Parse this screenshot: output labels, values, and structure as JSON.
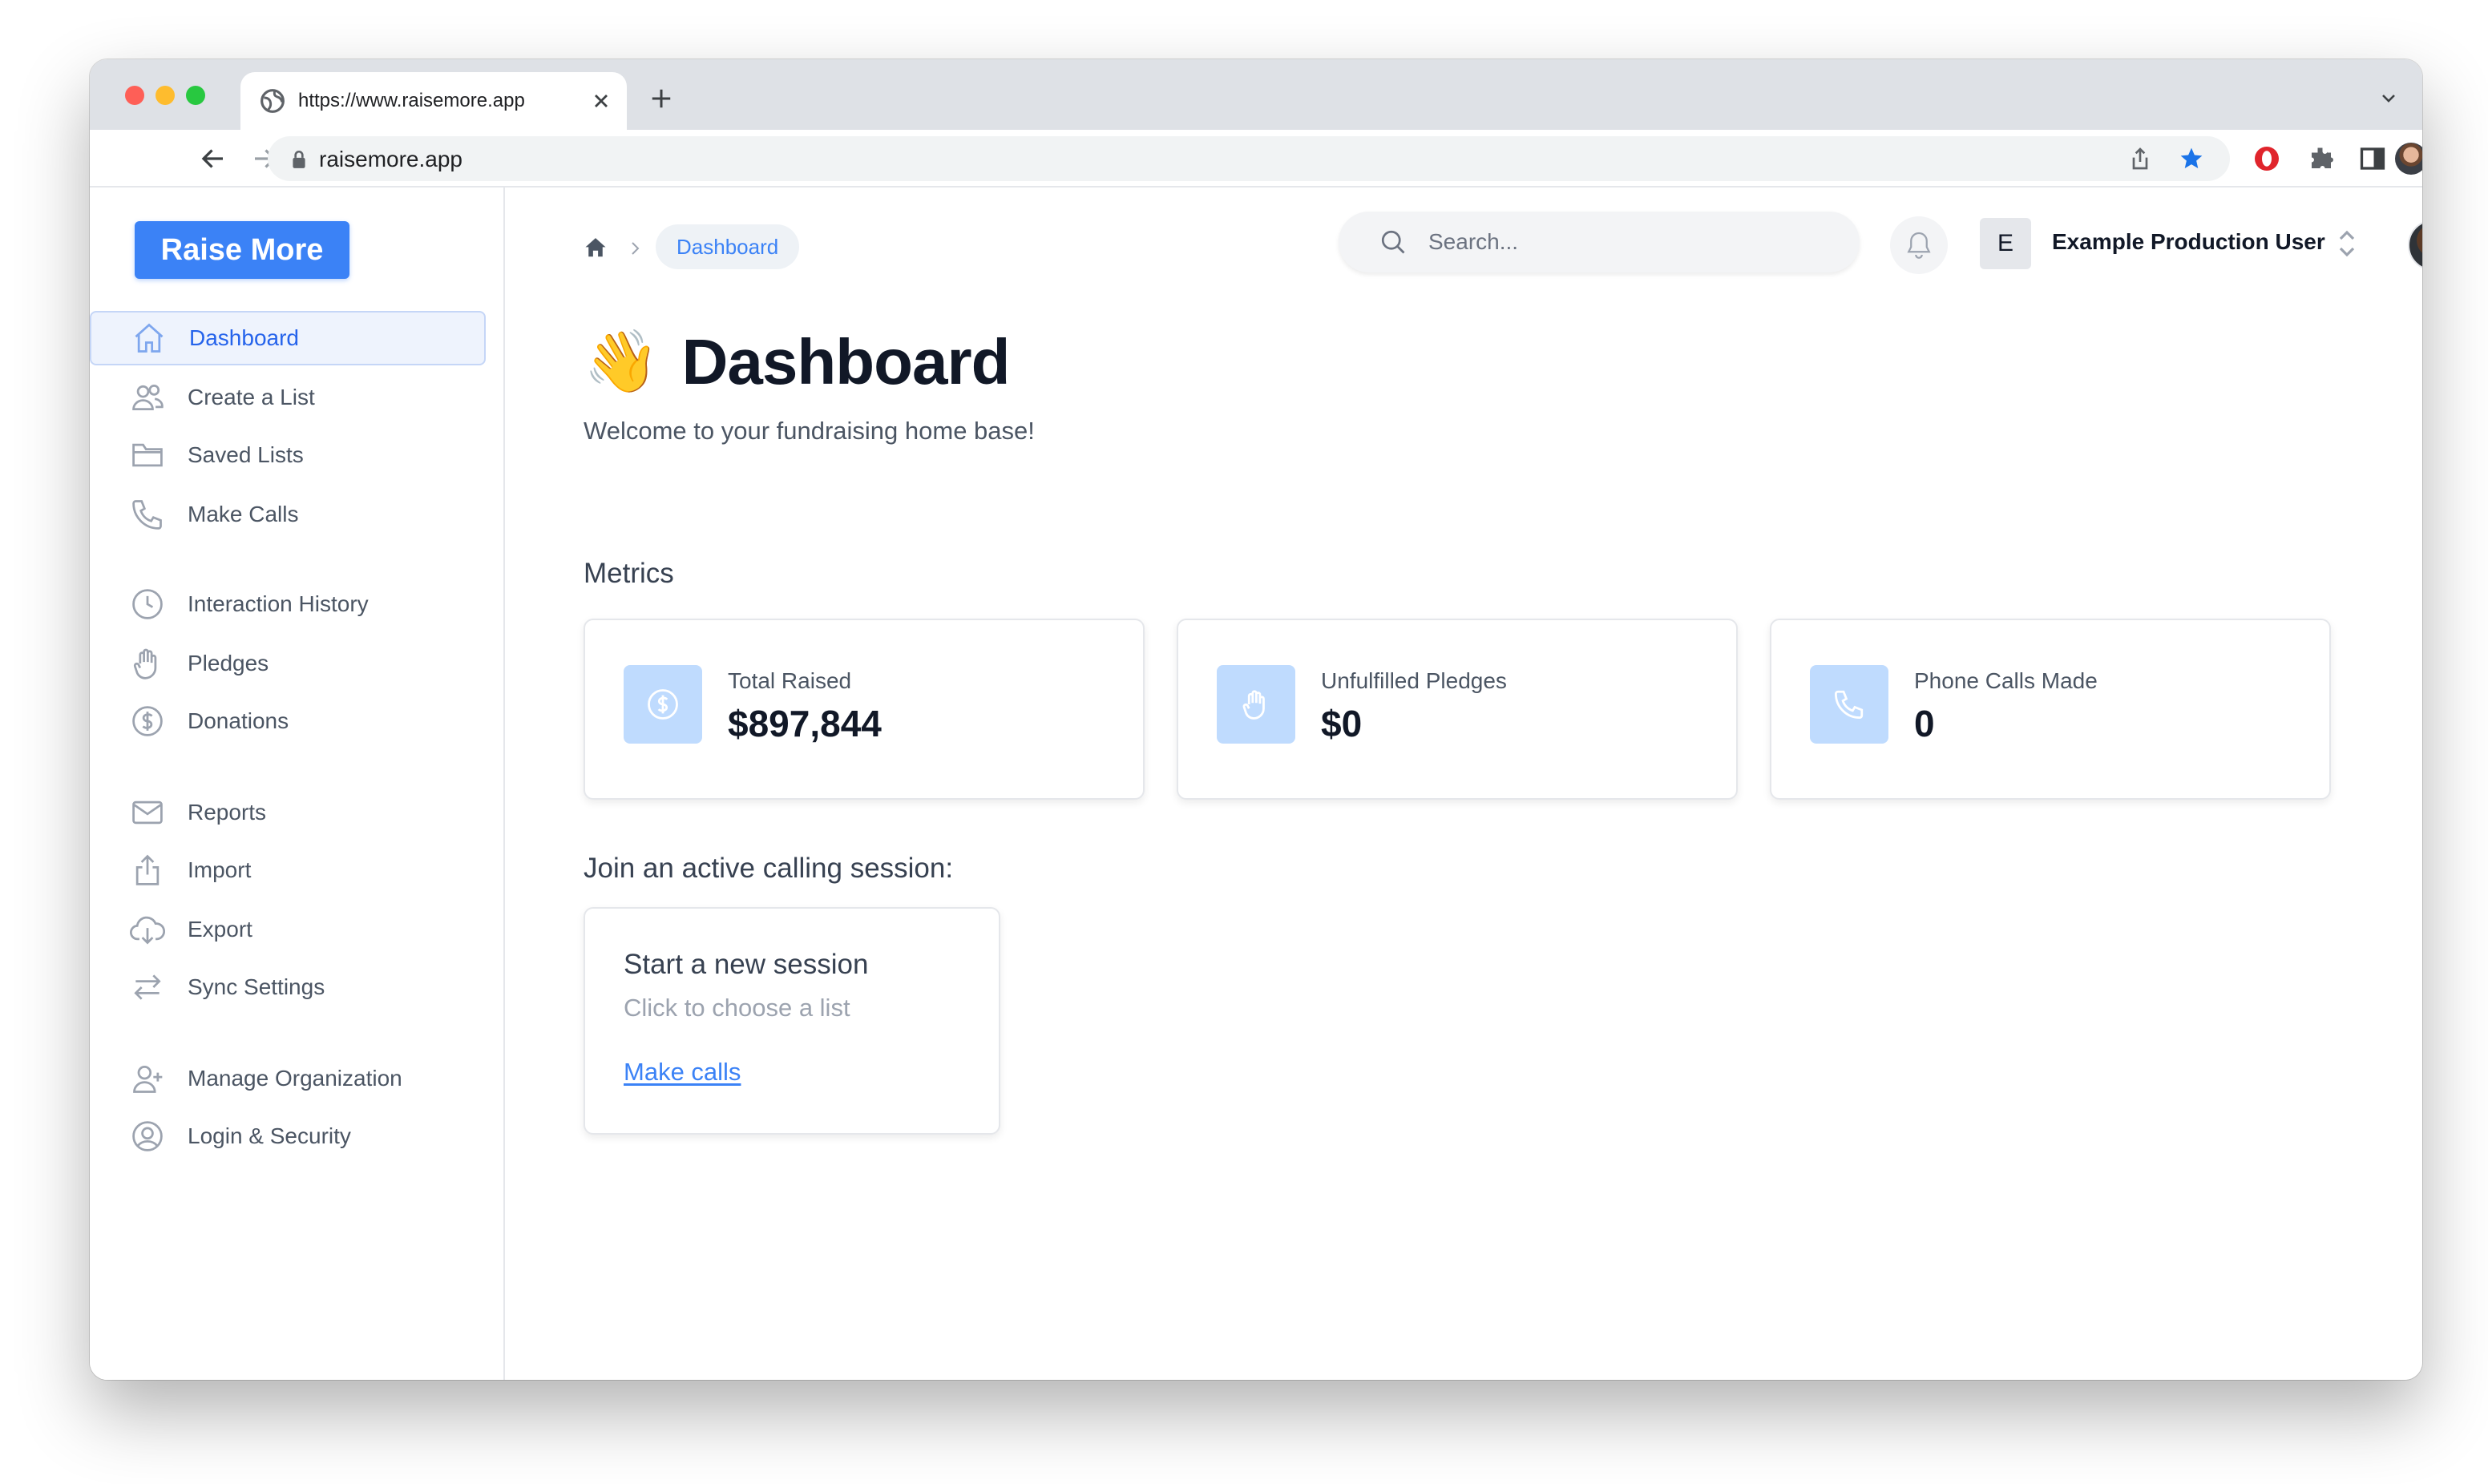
{
  "browser": {
    "tab_title": "https://www.raisemore.app",
    "address": "raisemore.app"
  },
  "app": {
    "logo": "Raise More",
    "nav": [
      {
        "label": "Dashboard",
        "icon": "home-icon",
        "active": true
      },
      {
        "label": "Create a List",
        "icon": "users-icon"
      },
      {
        "label": "Saved Lists",
        "icon": "folder-icon"
      },
      {
        "label": "Make Calls",
        "icon": "phone-icon"
      },
      {
        "label": "Interaction History",
        "icon": "clock-icon"
      },
      {
        "label": "Pledges",
        "icon": "hand-icon"
      },
      {
        "label": "Donations",
        "icon": "dollar-circle-icon"
      },
      {
        "label": "Reports",
        "icon": "mail-icon"
      },
      {
        "label": "Import",
        "icon": "upload-icon"
      },
      {
        "label": "Export",
        "icon": "download-icon"
      },
      {
        "label": "Sync Settings",
        "icon": "arrows-swap-icon"
      },
      {
        "label": "Manage Organization",
        "icon": "user-plus-icon"
      },
      {
        "label": "Login & Security",
        "icon": "user-circle-icon"
      }
    ]
  },
  "header": {
    "breadcrumb": "Dashboard",
    "search_placeholder": "Search...",
    "org_initial": "E",
    "org_name": "Example Production User"
  },
  "page": {
    "emoji": "👋",
    "title": "Dashboard",
    "subtitle": "Welcome to your fundraising home base!",
    "metrics_heading": "Metrics",
    "metrics": [
      {
        "label": "Total Raised",
        "value": "$897,844",
        "icon": "dollar-icon"
      },
      {
        "label": "Unfulfilled Pledges",
        "value": "$0",
        "icon": "hand-icon"
      },
      {
        "label": "Phone Calls Made",
        "value": "0",
        "icon": "phone-icon"
      }
    ],
    "session_heading": "Join an active calling session:",
    "session_card": {
      "title": "Start a new session",
      "subtitle": "Click to choose a list",
      "link": "Make calls"
    }
  },
  "colors": {
    "accent": "#3b82f6",
    "icon_bg": "#bfdbfe",
    "active_nav_bg": "#eef3fd"
  }
}
